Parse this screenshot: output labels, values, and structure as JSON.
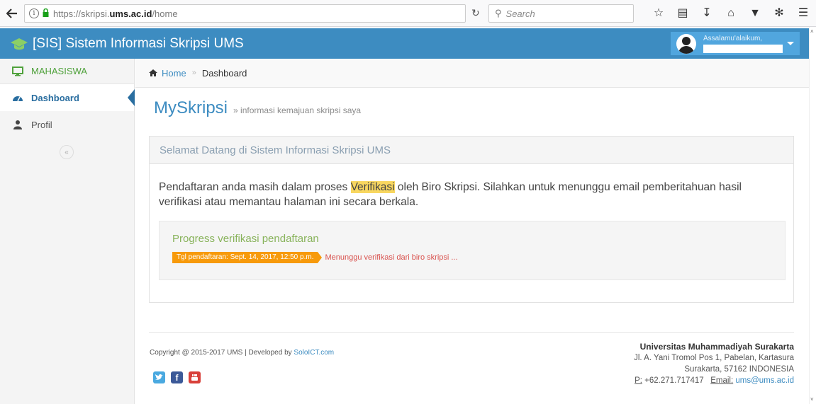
{
  "browser": {
    "url_prefix": "https://skripsi.",
    "url_domain": "ums.ac.id",
    "url_path": "/home",
    "search_placeholder": "Search"
  },
  "app": {
    "title": "[SIS] Sistem Informasi Skripsi UMS",
    "greeting": "Assalamu'alaikum,"
  },
  "sidebar": {
    "section": "MAHASISWA",
    "items": [
      {
        "label": "Dashboard"
      },
      {
        "label": "Profil"
      }
    ],
    "collapse": "«"
  },
  "breadcrumb": {
    "home": "Home",
    "sep": "»",
    "current": "Dashboard"
  },
  "page": {
    "title": "MySkripsi",
    "subtitle": "» informasi kemajuan skripsi saya"
  },
  "panel": {
    "heading": "Selamat Datang di Sistem Informasi Skripsi UMS",
    "notice_before": "Pendaftaran anda masih dalam proses ",
    "notice_highlight": "Verifikasi",
    "notice_after": " oleh Biro Skripsi. Silahkan untuk menunggu email pemberitahuan hasil verifikasi atau memantau halaman ini secara berkala.",
    "progress_title": "Progress verifikasi pendaftaran",
    "date_tag": "Tgl pendaftaran: Sept. 14, 2017, 12:50 p.m.",
    "waiting": "Menunggu verifikasi dari biro skripsi ..."
  },
  "footer": {
    "copyright_text": "Copyright @ 2015-2017 UMS | Developed by ",
    "developer": "SoloICT.com",
    "univ_name": "Universitas Muhammadiyah Surakarta",
    "address1": "Jl. A. Yani Tromol Pos 1, Pabelan, Kartasura",
    "address2": "Surakarta, 57162 INDONESIA",
    "phone_label": "P:",
    "phone": " +62.271.717417",
    "email_label": "Email:",
    "email": " ums@ums.ac.id"
  },
  "colors": {
    "header": "#3d8cc1",
    "user_box": "#51a6de",
    "highlight": "#f8d760",
    "date_tag": "#f79a0b",
    "progress_title": "#88b35b"
  }
}
